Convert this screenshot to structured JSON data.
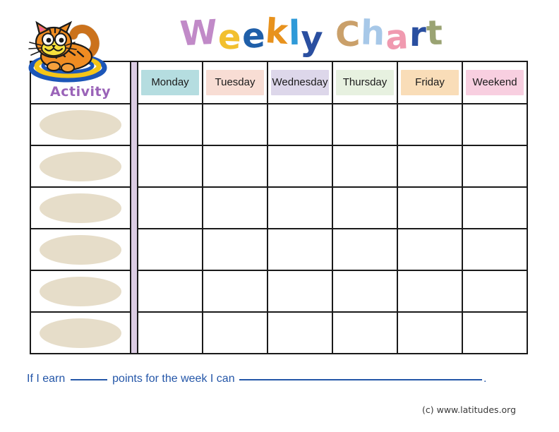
{
  "title": {
    "text": "Weekly Chart",
    "letters": [
      {
        "ch": "W",
        "color": "#c18ac8"
      },
      {
        "ch": "e",
        "color": "#f2c02e"
      },
      {
        "ch": "e",
        "color": "#1f5fa9"
      },
      {
        "ch": "k",
        "color": "#e8921d"
      },
      {
        "ch": "l",
        "color": "#2f9ad8"
      },
      {
        "ch": "y",
        "color": "#2a4fa0"
      },
      {
        "ch": "C",
        "color": "#caa06a"
      },
      {
        "ch": "h",
        "color": "#a7c8e8"
      },
      {
        "ch": "a",
        "color": "#f09ab0"
      },
      {
        "ch": "r",
        "color": "#2a4fa0"
      },
      {
        "ch": "t",
        "color": "#9aa373"
      }
    ]
  },
  "artwork": {
    "cat_icon": "tiger-cat-on-rug-clipart"
  },
  "table": {
    "activity_header": "Activity",
    "activity_header_color": "#9a63b8",
    "strip_color": "#dccde4",
    "ellipse_color": "#e6ddc9",
    "border_color": "#1a1a1a",
    "days": [
      {
        "label": "Monday",
        "color": "#b5dde0"
      },
      {
        "label": "Tuesday",
        "color": "#f8ddd4"
      },
      {
        "label": "Wednesday",
        "color": "#ddd7ea"
      },
      {
        "label": "Thursday",
        "color": "#e7f1e0"
      },
      {
        "label": "Friday",
        "color": "#f9ddb8"
      },
      {
        "label": "Weekend",
        "color": "#f8cfe0"
      }
    ],
    "row_count": 6,
    "rows": [
      {
        "activity": "",
        "values": [
          "",
          "",
          "",
          "",
          "",
          ""
        ]
      },
      {
        "activity": "",
        "values": [
          "",
          "",
          "",
          "",
          "",
          ""
        ]
      },
      {
        "activity": "",
        "values": [
          "",
          "",
          "",
          "",
          "",
          ""
        ]
      },
      {
        "activity": "",
        "values": [
          "",
          "",
          "",
          "",
          "",
          ""
        ]
      },
      {
        "activity": "",
        "values": [
          "",
          "",
          "",
          "",
          "",
          ""
        ]
      },
      {
        "activity": "",
        "values": [
          "",
          "",
          "",
          "",
          "",
          ""
        ]
      }
    ]
  },
  "sentence": {
    "part1": "If I earn",
    "part2": "points for the week I can",
    "part3": ".",
    "blank1_value": "",
    "blank2_value": "",
    "color": "#2456a8"
  },
  "footer": {
    "text": "(c) www.latitudes.org"
  }
}
